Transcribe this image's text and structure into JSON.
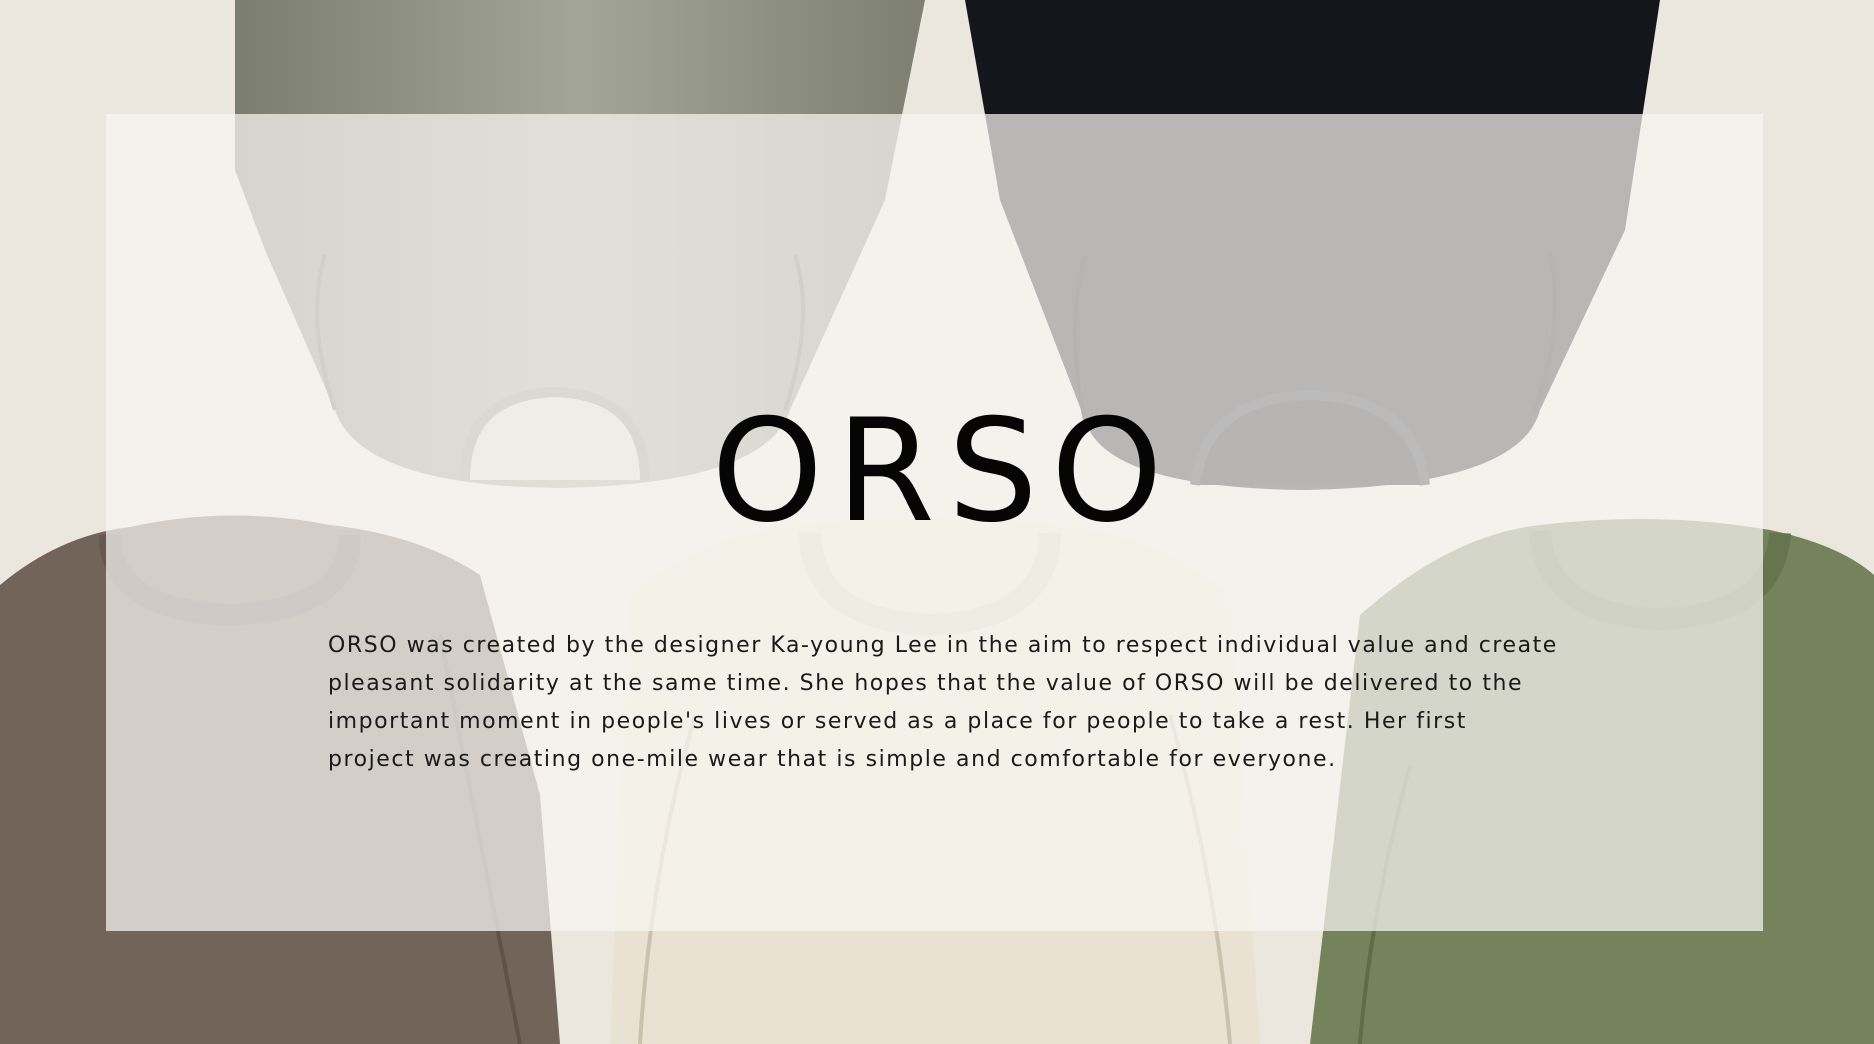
{
  "brand": {
    "name": "ORSO"
  },
  "description": "ORSO was created by the designer Ka-young Lee in the aim to respect individual value and create pleasant solidarity at the same time. She hopes that the value of ORSO will be delivered to the important moment in people's lives or served as a place for people to take a rest. Her first project was creating one-mile wear that is simple and comfortable for everyone.",
  "colors": {
    "background": "#ebe7df",
    "overlay": "#f8f7f3",
    "text": "#050505",
    "sweater_olive_grey": "#8e9180",
    "sweater_black": "#15151c",
    "sweater_brown": "#73645a",
    "sweater_cream": "#e9e1d1",
    "sweater_green": "#75835d"
  }
}
